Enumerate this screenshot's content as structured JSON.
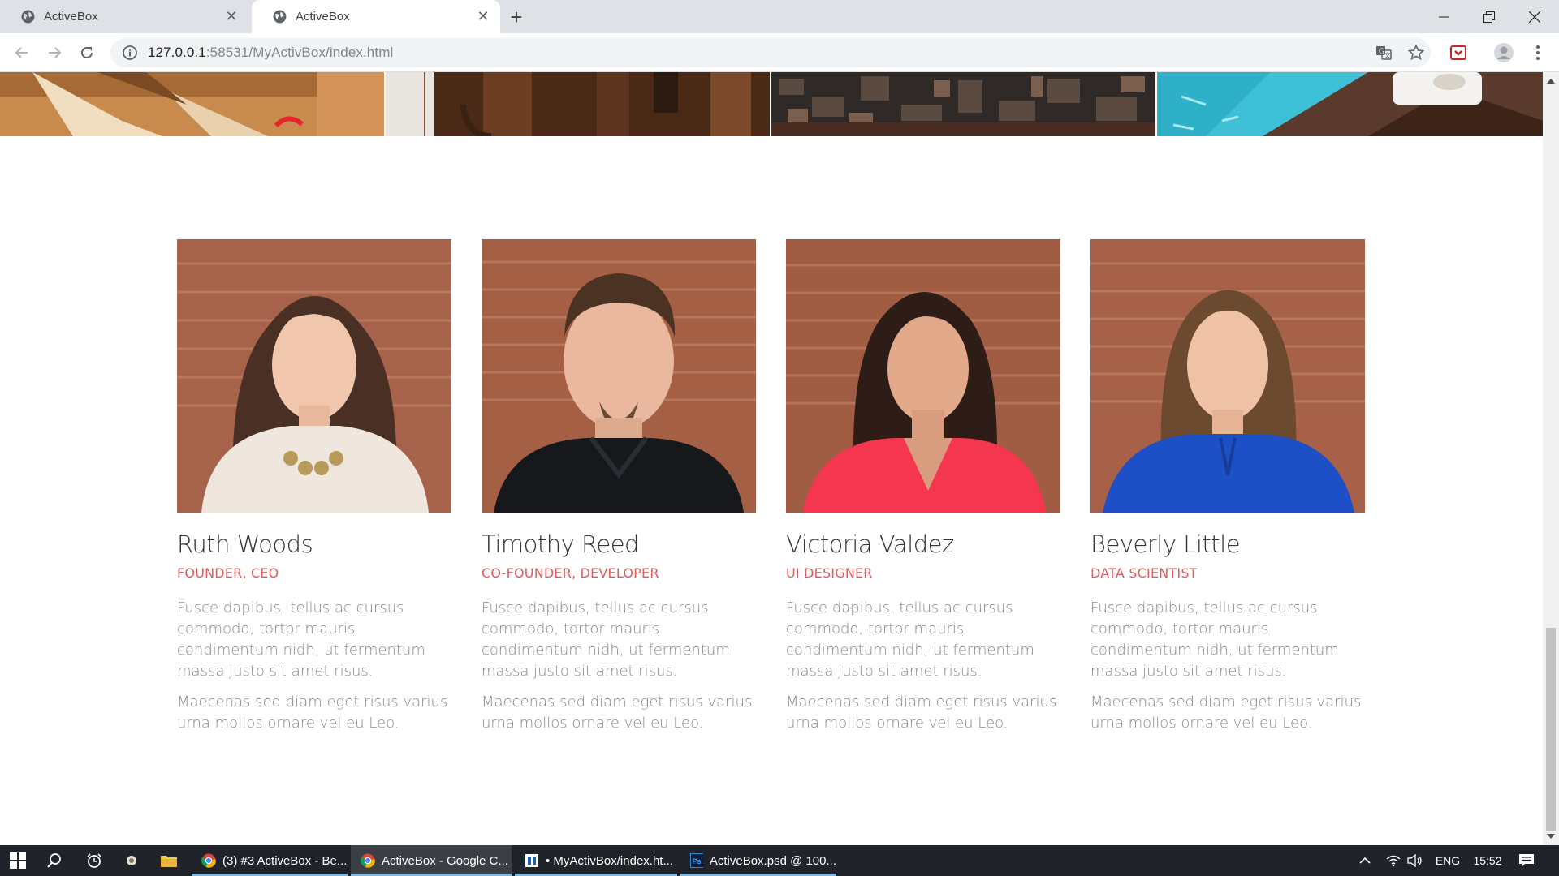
{
  "browser": {
    "tabs": [
      {
        "title": "ActiveBox",
        "active": false
      },
      {
        "title": "ActiveBox",
        "active": true
      }
    ],
    "url_host": "127.0.0.1",
    "url_rest": ":58531/MyActivBox/index.html"
  },
  "team": {
    "members": [
      {
        "name": "Ruth Woods",
        "role": "FOUNDER, CEO",
        "bio1": "Fusce dapibus, tellus ac cursus commodo, tortor mauris condimentum nidh, ut fermentum massa justo sit amet risus.",
        "bio2": "Maecenas sed diam eget risus varius urna mollos ornare vel eu Leo.",
        "shirt": "#efe7dd",
        "hair": "#4a3024"
      },
      {
        "name": "Timothy Reed",
        "role": "CO-FOUNDER, DEVELOPER",
        "bio1": "Fusce dapibus, tellus ac cursus commodo, tortor mauris condimentum nidh, ut fermentum massa justo sit amet risus.",
        "bio2": "Maecenas sed diam eget risus varius urna mollos ornare vel eu Leo.",
        "shirt": "#16181c",
        "hair": "#4b3222"
      },
      {
        "name": "Victoria Valdez",
        "role": "UI DESIGNER",
        "bio1": "Fusce dapibus, tellus ac cursus commodo, tortor mauris condimentum nidh, ut fermentum massa justo sit amet risus.",
        "bio2": "Maecenas sed diam eget risus varius urna mollos ornare vel eu Leo.",
        "shirt": "#f5364f",
        "hair": "#2e1d16"
      },
      {
        "name": "Beverly Little",
        "role": "DATA SCIENTIST",
        "bio1": "Fusce dapibus, tellus ac cursus commodo, tortor mauris condimentum nidh, ut fermentum massa justo sit amet risus.",
        "bio2": "Maecenas sed diam eget risus varius urna mollos ornare vel eu Leo.",
        "shirt": "#1d4fc7",
        "hair": "#6b4a30"
      }
    ]
  },
  "taskbar": {
    "apps": [
      {
        "label": "(3) #3 ActiveBox - Be...",
        "icon": "chrome-icon"
      },
      {
        "label": "ActiveBox - Google C...",
        "icon": "chrome-icon"
      },
      {
        "label": "• MyActivBox/index.ht...",
        "icon": "editor-icon"
      },
      {
        "label": "ActiveBox.psd @ 100...",
        "icon": "photoshop-icon"
      }
    ],
    "language": "ENG",
    "clock": "15:52"
  },
  "colors": {
    "accent": "#e25a5a",
    "name_text": "#333333",
    "body_text": "#888888",
    "brick": "#a35d43"
  }
}
